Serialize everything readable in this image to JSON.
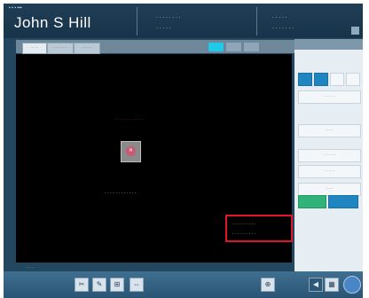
{
  "header": {
    "menu_text": "▪ ▪ ▪  ▪▪▪",
    "patient_name": "John S Hill",
    "info_col1_line1": "· ·  · · · · · ·",
    "info_col1_line2": "· · · · ·",
    "info_col2_line1": "· · ·  · ·",
    "info_col2_line2": "· · · · ·  · ·"
  },
  "tabs": [
    "· · ·",
    "· · · · ·",
    "· · · ·"
  ],
  "viewer": {
    "title_text": "· · · · · · · · · · ·",
    "caption_text": "· · · · · · · · · · · ·",
    "bottom_left_text": "· · ·",
    "box_line1": "· · · · · · · · ·",
    "box_line2": "· · · · · · · · ·"
  },
  "right_panel": {
    "items": [
      "· · · ·",
      "· · ·",
      "· · · · ·",
      "· · · ·",
      "· · ·"
    ]
  },
  "colors": {
    "accent": "#22c8e8",
    "highlight_box": "#e0142a",
    "viewer_bg": "#000000",
    "title_text": "#e23fb0"
  }
}
